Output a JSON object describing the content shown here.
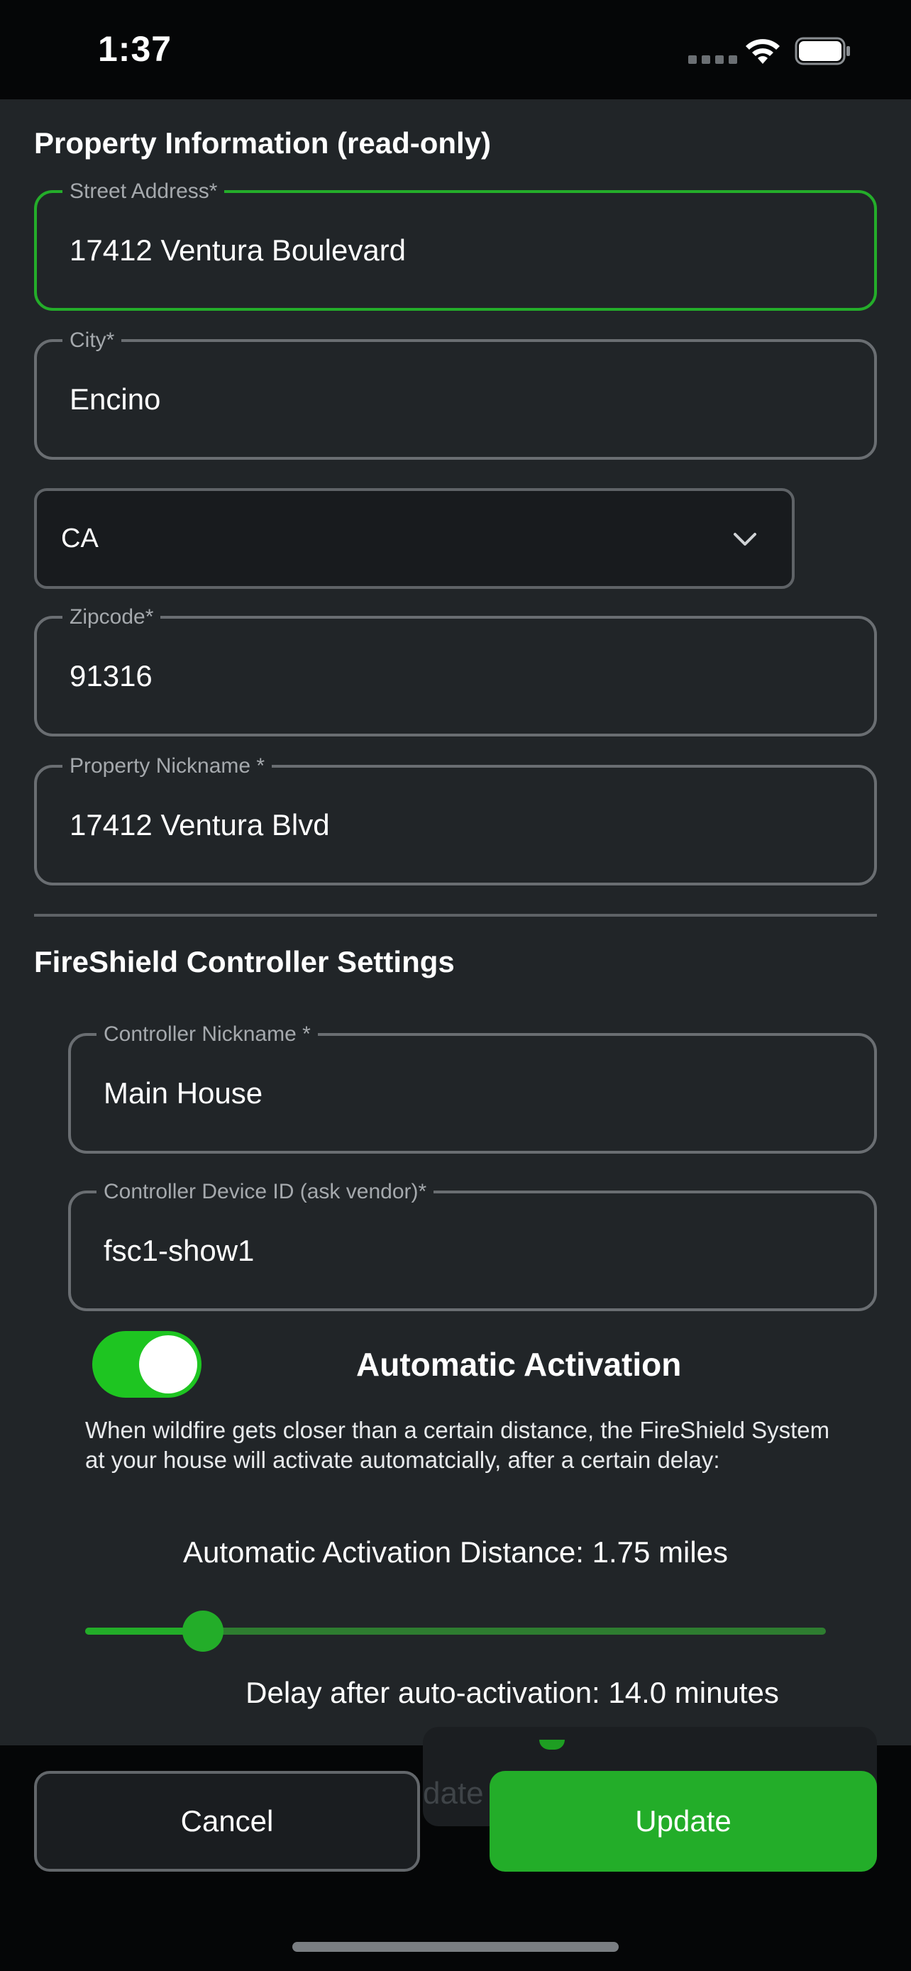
{
  "status_bar": {
    "time": "1:37"
  },
  "property_section": {
    "title": "Property Information (read-only)",
    "street": {
      "label": "Street Address*",
      "value": "17412 Ventura Boulevard"
    },
    "city": {
      "label": "City*",
      "value": "Encino"
    },
    "state": {
      "value": "CA"
    },
    "zipcode": {
      "label": "Zipcode*",
      "value": "91316"
    },
    "nickname": {
      "label": "Property Nickname *",
      "value": "17412 Ventura Blvd"
    }
  },
  "controller_section": {
    "title": "FireShield Controller Settings",
    "controller_nickname": {
      "label": "Controller Nickname *",
      "value": "Main House"
    },
    "device_id": {
      "label": "Controller Device ID (ask vendor)*",
      "value": "fsc1-show1"
    },
    "auto_activation": {
      "label": "Automatic Activation",
      "enabled": true,
      "description": "When wildfire gets closer than a certain distance, the FireShield System at your house will activate automatcially, after a certain delay:"
    },
    "distance": {
      "label": "Automatic Activation Distance: 1.75 miles",
      "fraction": 0.14
    },
    "delay": {
      "label": "Delay after auto-activation: 14.0 minutes"
    }
  },
  "actions": {
    "cancel_label": "Cancel",
    "update_label": "Update",
    "ghost_label": "date"
  },
  "colors": {
    "accent": "#23ad29",
    "background": "#212528",
    "border": "#6a6e72"
  }
}
